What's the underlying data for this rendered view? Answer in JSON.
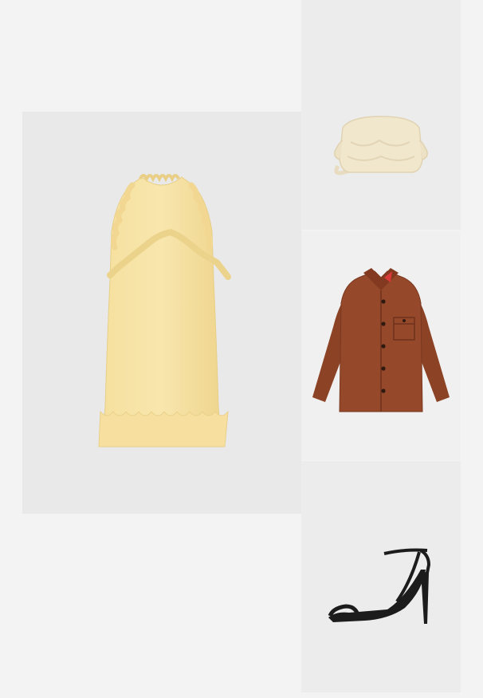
{
  "outfit": {
    "items": [
      {
        "name": "dress",
        "color": "#f3dc98"
      },
      {
        "name": "bag",
        "color": "#efe6cf"
      },
      {
        "name": "jacket",
        "color": "#8f4325"
      },
      {
        "name": "sandal",
        "color": "#1c1c1c"
      }
    ]
  },
  "colors": {
    "page_background": "#f3f3f3",
    "tile_background": "#ebebeb"
  }
}
